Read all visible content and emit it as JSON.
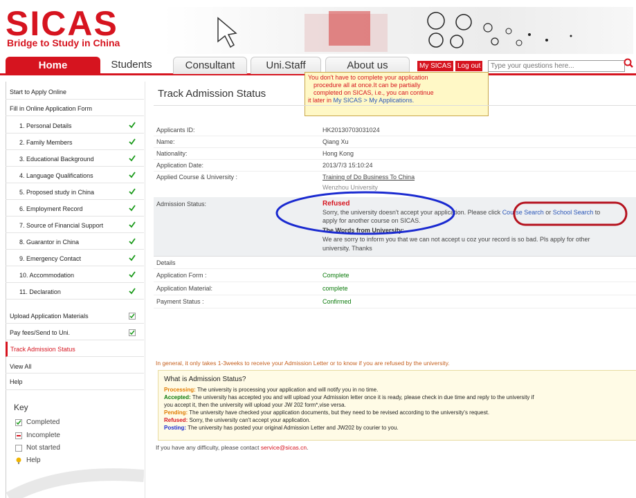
{
  "header": {
    "logo": "SICAS",
    "tagline": "Bridge to Study in China"
  },
  "nav": {
    "tabs": [
      "Home",
      "Students",
      "Consultant",
      "Uni.Staff",
      "About us"
    ],
    "my_sicas": "My SICAS",
    "logout": "Log out",
    "search_placeholder": "Type your questions here..."
  },
  "tooltip": {
    "line1": "You don't have to complete your application",
    "line2": "procedure all at once.It can be partially",
    "line3": "completed on SICAS, i.e., you can continue",
    "line4a": "it later in ",
    "line4b": "My SICAS > My Applications."
  },
  "sidebar": {
    "start": "Start to Apply Online",
    "fill": "Fill in Online Application Form",
    "steps": [
      "1. Personal Details",
      "2. Family Members",
      "3. Educational Background",
      "4. Language Qualifications",
      "5. Proposed study in China",
      "6. Employment Record",
      "7. Source of Financial Support",
      "8. Guarantor in China",
      "9. Emergency Contact",
      "10. Accommodation",
      "11. Declaration"
    ],
    "upload": "Upload Application Materials",
    "pay": "Pay fees/Send to Uni.",
    "track": "Track Admission Status",
    "view_all": "View All",
    "help": "Help",
    "key_title": "Key",
    "key_items": [
      "Completed",
      "Incomplete",
      "Not started",
      "Help"
    ]
  },
  "main": {
    "title": "Track Admission Status",
    "fields": [
      {
        "label": "Applicants ID:",
        "value": "HK20130703031024"
      },
      {
        "label": "Name:",
        "value": "Qiang Xu"
      },
      {
        "label": "Nationality:",
        "value": "Hong Kong"
      },
      {
        "label": "Application Date:",
        "value": "2013/7/3 15:10:24"
      },
      {
        "label": "Applied Course & University :",
        "value": "Training of Do Business To China"
      }
    ],
    "university": "Wenzhou University",
    "admission_label": "Admission Status:",
    "refused": "Refused",
    "refused_msg_1": "Sorry, the university doesn't accept your application. Please click ",
    "course_search": "Course Search",
    "or": " or ",
    "school_search": "School Search",
    "refused_msg_2": " to",
    "refused_msg_3": "apply for another course on SICAS.",
    "words_title": "The Words from University:",
    "words_1": "We are sorry to inform you that we can not accept u coz your record is so bad. Pls apply for other",
    "words_2": "university. Thanks",
    "details_label": "Details",
    "details": [
      {
        "label": "Application Form :",
        "value": "Complete"
      },
      {
        "label": "Application Material:",
        "value": "complete"
      },
      {
        "label": "Payment Status :",
        "value": "Confirmed"
      }
    ],
    "general_note": "In general, it only takes 1-3weeks to receive your Admission Letter or to know if you are refused by the university.",
    "info_title": "What is Admission Status?",
    "info": [
      {
        "term": "Processing:",
        "text": " The university is processing your application and will notify you in no time.",
        "color": "#e07b00"
      },
      {
        "term": "Accepted:",
        "text": " The university has accepted you and will upload your Admission letter once it is ready, please check in due time and reply to the university if",
        "color": "#0a7a0a"
      },
      {
        "term": "",
        "text": "you accept it, then the university will upload your JW 202 form*,vise versa.",
        "color": "#222"
      },
      {
        "term": "Pending:",
        "text": " The university have checked your application documents, but they need to be revised according to the university's request.",
        "color": "#e07b00"
      },
      {
        "term": "Refused:",
        "text": " Sorry, the university can't accept your application.",
        "color": "#d6141f"
      },
      {
        "term": "Posting:",
        "text": " The university has posted your original Admission Letter and JW202 by courier to you.",
        "color": "#1a2ad0"
      }
    ],
    "contact_text": "If you have any difficulty, please contact ",
    "contact_email": "service@sicas.cn",
    "contact_end": "."
  },
  "colors": {
    "brand": "#d6141f",
    "annotation_blue": "#1a2ad0",
    "annotation_red": "#b5121e"
  }
}
